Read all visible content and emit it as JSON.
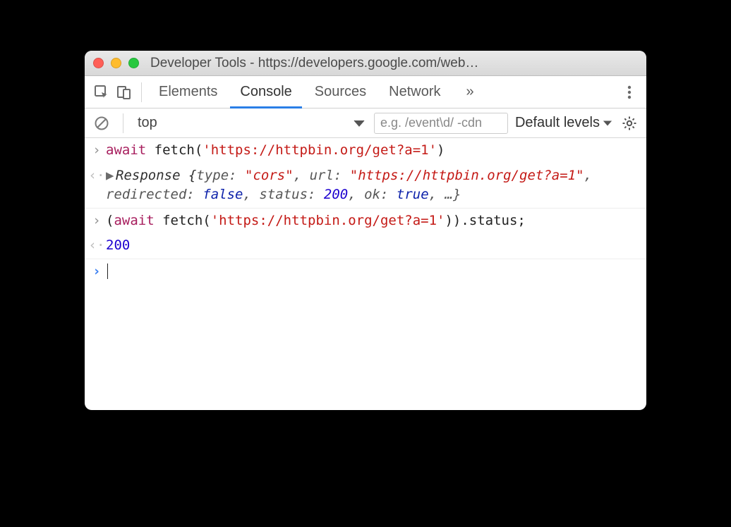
{
  "window": {
    "title": "Developer Tools - https://developers.google.com/web…"
  },
  "tabs": {
    "elements": "Elements",
    "console": "Console",
    "sources": "Sources",
    "network": "Network",
    "more_glyph": "»"
  },
  "toolbar": {
    "context": "top",
    "filter_placeholder": "e.g. /event\\d/ -cdn",
    "levels": "Default levels"
  },
  "console_entries": {
    "e1": {
      "await": "await",
      "func": " fetch(",
      "url": "'https://httpbin.org/get?a=1'",
      "close": ")"
    },
    "e2": {
      "class": "Response",
      "open": " {",
      "p_type": "type: ",
      "v_type": "\"cors\"",
      "c1": ", ",
      "p_url": "url: ",
      "v_url": "\"https://httpbin.org/get?a=1\"",
      "c2": ", ",
      "p_redir": "redirected: ",
      "v_redir": "false",
      "c3": ", ",
      "p_status": "status: ",
      "v_status": "200",
      "c4": ", ",
      "p_ok": "ok: ",
      "v_ok": "true",
      "c5": ", …}"
    },
    "e3": {
      "open": "(",
      "await": "await",
      "func": " fetch(",
      "url": "'https://httpbin.org/get?a=1'",
      "close_inner": ")",
      "tail": ").status;"
    },
    "e4": {
      "value": "200"
    }
  }
}
